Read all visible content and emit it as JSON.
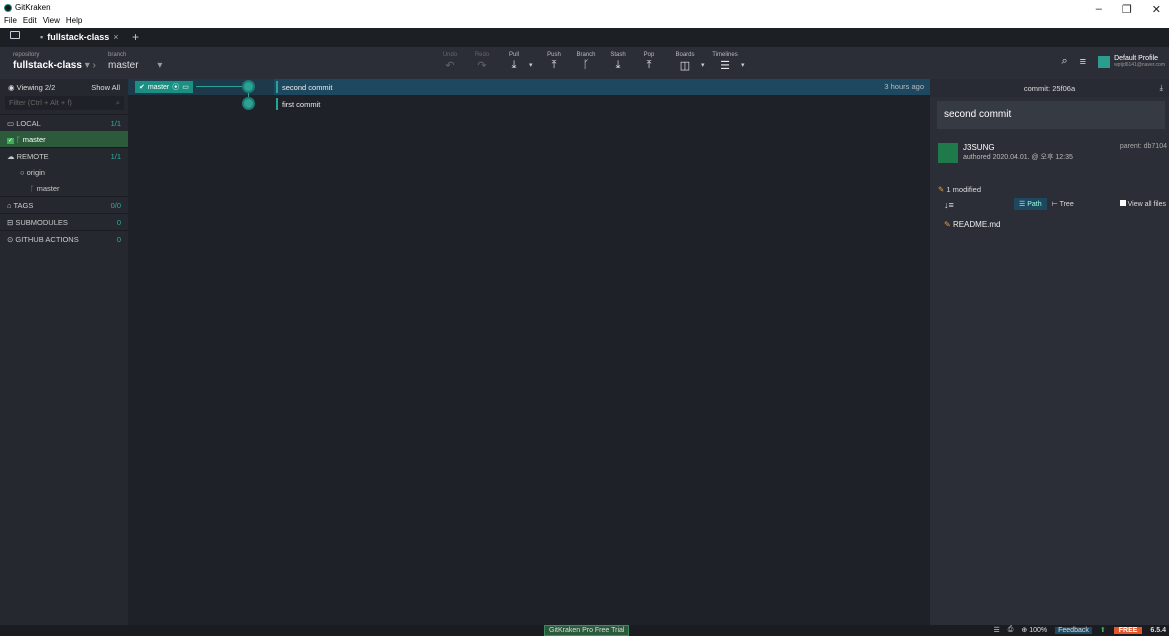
{
  "window": {
    "app_title": "GitKraken",
    "menu": [
      "File",
      "Edit",
      "View",
      "Help"
    ],
    "minimize": "–",
    "maximize": "❐",
    "close": "✕"
  },
  "tabs": {
    "active": "fullstack-class",
    "close": "×",
    "add": "+"
  },
  "toolbar": {
    "repo_label": "repository",
    "repo_value": "fullstack-class",
    "branch_label": "branch",
    "branch_value": "master",
    "buttons": [
      {
        "label": "Undo",
        "icon": "↶"
      },
      {
        "label": "Redo",
        "icon": "↷"
      },
      {
        "label": "Pull",
        "icon": "⤓"
      },
      {
        "label": "Push",
        "icon": "⤒"
      },
      {
        "label": "Branch",
        "icon": "ᚴ"
      },
      {
        "label": "Stash",
        "icon": "⤓"
      },
      {
        "label": "Pop",
        "icon": "⤒"
      },
      {
        "label": "Boards",
        "icon": "◫"
      },
      {
        "label": "Timelines",
        "icon": "☰"
      }
    ],
    "profile_name": "Default Profile",
    "profile_email": "wptjd6141@naver.com"
  },
  "left": {
    "viewing": "Viewing 2/2",
    "show_all": "Show All",
    "filter_placeholder": "Filter (Ctrl + Alt + f)",
    "local": "LOCAL",
    "local_count": "1/1",
    "local_branch": "master",
    "remote": "REMOTE",
    "remote_count": "1/1",
    "origin": "origin",
    "origin_branch": "master",
    "tags": "TAGS",
    "tags_count": "0/0",
    "submodules": "SUBMODULES",
    "submodules_count": "0",
    "actions": "GITHUB ACTIONS",
    "actions_count": "0"
  },
  "graph": {
    "branch_pill": "master",
    "commits": [
      {
        "message": "second commit",
        "time": "3 hours ago"
      },
      {
        "message": "first commit",
        "time": ""
      }
    ]
  },
  "detail": {
    "commit_label": "commit: 25f06a",
    "subject": "second commit",
    "author": "J3SUNG",
    "authored": "authored 2020.04.01. @ 오후 12:35",
    "parent": "parent: db7104",
    "modified": "1 modified",
    "path": "Path",
    "tree": "Tree",
    "view_all": "View all files",
    "file": "README.md"
  },
  "status": {
    "trial": "GitKraken Pro Free Trial",
    "zoom": "100%",
    "feedback": "Feedback",
    "free": "FREE",
    "version": "6.5.4"
  },
  "colors": {
    "accent": "#2aa396",
    "free_badge": "#e2582a",
    "selected_row": "#2e5a3c"
  }
}
